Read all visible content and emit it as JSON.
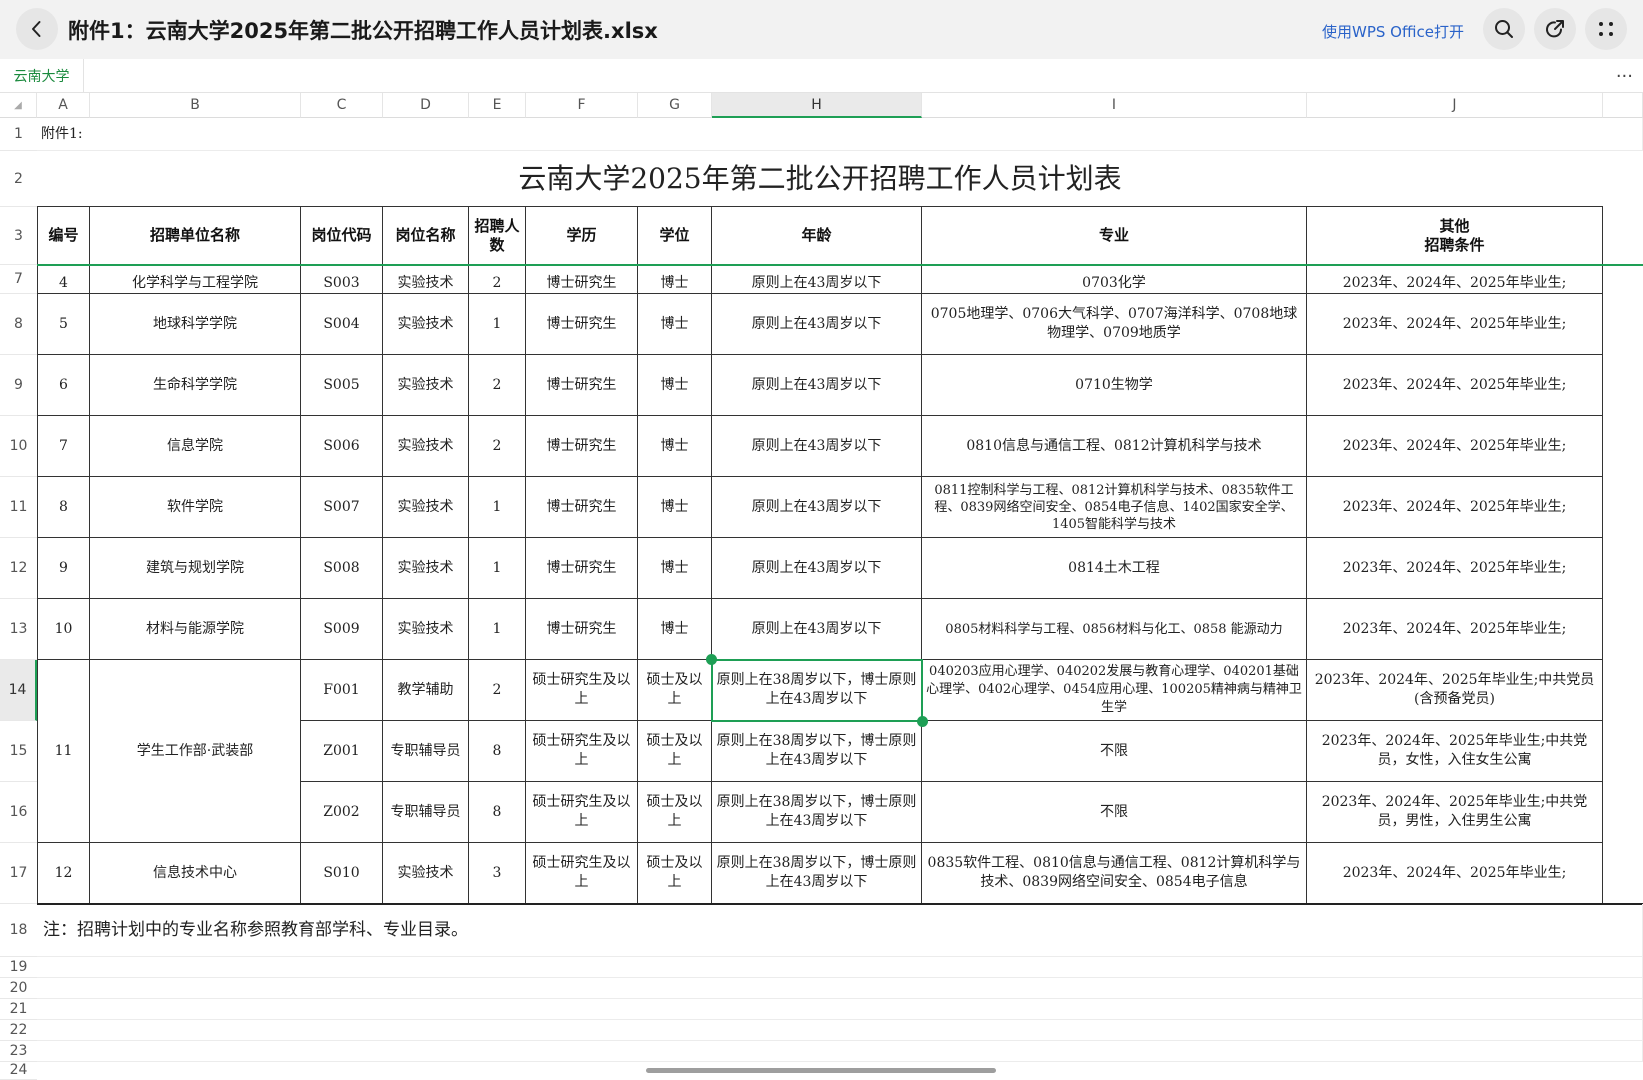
{
  "topbar": {
    "title": "附件1：云南大学2025年第二批公开招聘工作人员计划表.xlsx",
    "open_with": "使用WPS Office打开"
  },
  "sheet": {
    "tab": "云南大学",
    "more": "···"
  },
  "columns": [
    "A",
    "B",
    "C",
    "D",
    "E",
    "F",
    "G",
    "H",
    "I",
    "J"
  ],
  "row_numbers": [
    "1",
    "2",
    "3",
    "7",
    "8",
    "9",
    "10",
    "11",
    "12",
    "13",
    "14",
    "15",
    "16",
    "17",
    "18",
    "19",
    "20",
    "21",
    "22",
    "23",
    "24"
  ],
  "a1": "附件1:",
  "table_title": "云南大学2025年第二批公开招聘工作人员计划表",
  "headers": {
    "num": "编号",
    "unit": "招聘单位名称",
    "code": "岗位代码",
    "post": "岗位名称",
    "count": "招聘人数",
    "edu": "学历",
    "degree": "学位",
    "age": "年龄",
    "major": "专业",
    "other": "其他\n招聘条件"
  },
  "cut_row": {
    "num": "4",
    "unit": "化学科学与工程学院",
    "code": "S003",
    "post": "实验技术",
    "count": "2",
    "edu": "博士研究生",
    "degree": "博士",
    "age": "原则上在43周岁以下",
    "major": "0703化学",
    "other": "2023年、2024年、2025年毕业生;"
  },
  "rows": [
    {
      "num": "5",
      "unit": "地球科学学院",
      "code": "S004",
      "post": "实验技术",
      "count": "1",
      "edu": "博士研究生",
      "degree": "博士",
      "age": "原则上在43周岁以下",
      "major": "0705地理学、0706大气科学、0707海洋科学、0708地球物理学、0709地质学",
      "other": "2023年、2024年、2025年毕业生;"
    },
    {
      "num": "6",
      "unit": "生命科学学院",
      "code": "S005",
      "post": "实验技术",
      "count": "2",
      "edu": "博士研究生",
      "degree": "博士",
      "age": "原则上在43周岁以下",
      "major": "0710生物学",
      "other": "2023年、2024年、2025年毕业生;"
    },
    {
      "num": "7",
      "unit": "信息学院",
      "code": "S006",
      "post": "实验技术",
      "count": "2",
      "edu": "博士研究生",
      "degree": "博士",
      "age": "原则上在43周岁以下",
      "major": "0810信息与通信工程、0812计算机科学与技术",
      "other": "2023年、2024年、2025年毕业生;"
    },
    {
      "num": "8",
      "unit": "软件学院",
      "code": "S007",
      "post": "实验技术",
      "count": "1",
      "edu": "博士研究生",
      "degree": "博士",
      "age": "原则上在43周岁以下",
      "major": "0811控制科学与工程、0812计算机科学与技术、0835软件工程、0839网络空间安全、0854电子信息、1402国家安全学、1405智能科学与技术",
      "other": "2023年、2024年、2025年毕业生;"
    },
    {
      "num": "9",
      "unit": "建筑与规划学院",
      "code": "S008",
      "post": "实验技术",
      "count": "1",
      "edu": "博士研究生",
      "degree": "博士",
      "age": "原则上在43周岁以下",
      "major": "0814土木工程",
      "other": "2023年、2024年、2025年毕业生;"
    },
    {
      "num": "10",
      "unit": "材料与能源学院",
      "code": "S009",
      "post": "实验技术",
      "count": "1",
      "edu": "博士研究生",
      "degree": "博士",
      "age": "原则上在43周岁以下",
      "major": "0805材料科学与工程、0856材料与化工、0858 能源动力",
      "other": "2023年、2024年、2025年毕业生;"
    },
    {
      "num": "11",
      "unit": "学生工作部·武装部",
      "code": "F001",
      "post": "教学辅助",
      "count": "2",
      "edu": "硕士研究生及以上",
      "degree": "硕士及以上",
      "age": "原则上在38周岁以下，博士原则上在43周岁以下",
      "major": "040203应用心理学、040202发展与教育心理学、040201基础心理学、0402心理学、0454应用心理、100205精神病与精神卫生学",
      "other": "2023年、2024年、2025年毕业生;中共党员(含预备党员)"
    },
    {
      "num": "",
      "unit": "",
      "code": "Z001",
      "post": "专职辅导员",
      "count": "8",
      "edu": "硕士研究生及以上",
      "degree": "硕士及以上",
      "age": "原则上在38周岁以下，博士原则上在43周岁以下",
      "major": "不限",
      "other": "2023年、2024年、2025年毕业生;中共党员，女性，入住女生公寓"
    },
    {
      "num": "",
      "unit": "",
      "code": "Z002",
      "post": "专职辅导员",
      "count": "8",
      "edu": "硕士研究生及以上",
      "degree": "硕士及以上",
      "age": "原则上在38周岁以下，博士原则上在43周岁以下",
      "major": "不限",
      "other": "2023年、2024年、2025年毕业生;中共党员，男性，入住男生公寓"
    },
    {
      "num": "12",
      "unit": "信息技术中心",
      "code": "S010",
      "post": "实验技术",
      "count": "3",
      "edu": "硕士研究生及以上",
      "degree": "硕士及以上",
      "age": "原则上在38周岁以下，博士原则上在43周岁以下",
      "major": "0835软件工程、0810信息与通信工程、0812计算机科学与技术、0839网络空间安全、0854电子信息",
      "other": "2023年、2024年、2025年毕业生;"
    }
  ],
  "note": "注：招聘计划中的专业名称参照教育部学科、专业目录。",
  "icons": {
    "back": "back-icon",
    "search": "search-icon",
    "share": "share-icon",
    "more": "more-icon"
  },
  "colors": {
    "accent": "#1e9f55",
    "link": "#2a63c9",
    "topbar": "#f2f2f2"
  }
}
